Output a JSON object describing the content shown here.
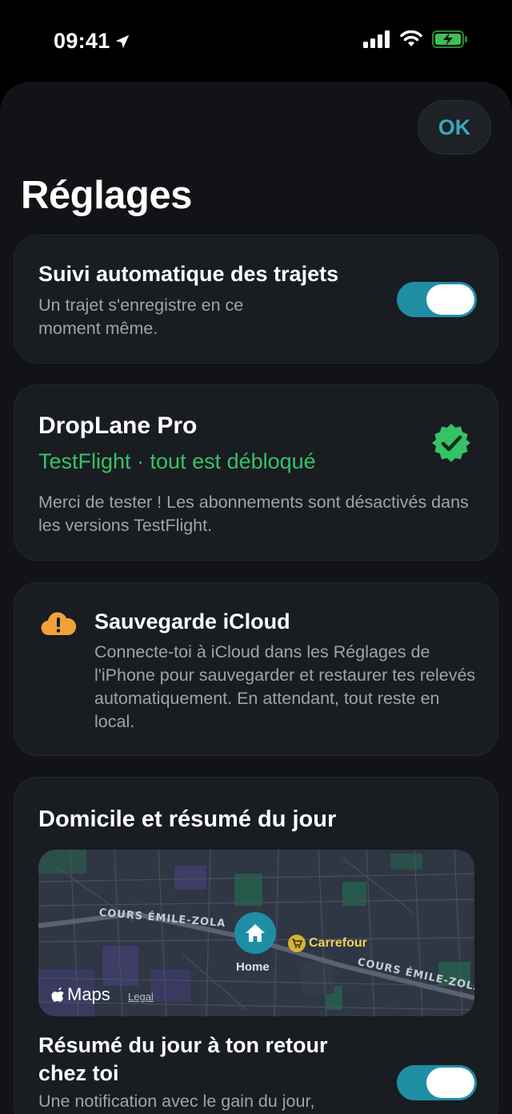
{
  "status": {
    "time": "09:41"
  },
  "header": {
    "ok_label": "OK",
    "title": "Réglages"
  },
  "tracking": {
    "title": "Suivi automatique des trajets",
    "subtitle": "Un trajet s'enregistre en ce moment même.",
    "enabled": true
  },
  "pro": {
    "title": "DropLane Pro",
    "status": "TestFlight · tout est débloqué",
    "description": "Merci de tester ! Les abonnements sont désactivés dans les versions TestFlight.",
    "badge_icon": "verified-badge-icon",
    "accent": "#36c266"
  },
  "icloud": {
    "title": "Sauvegarde iCloud",
    "description": "Connecte-toi à iCloud dans les Réglages de l'iPhone pour sauvegarder et restaurer tes relevés automatiquement. En attendant, tout reste en local.",
    "icon": "icloud-warning-icon",
    "accent": "#f0a23a"
  },
  "home": {
    "title": "Domicile et résumé du jour",
    "map": {
      "street_1": "COURS ÉMILE-ZOLA",
      "street_2": "COURS ÉMILE-ZOLA",
      "home_label": "Home",
      "poi_label": "Carrefour",
      "maps_brand": "Maps",
      "legal": "Legal"
    },
    "summary_title": "Résumé du jour à ton retour chez toi",
    "summary_sub": "Une notification avec le gain du jour,",
    "summary_enabled": true
  }
}
